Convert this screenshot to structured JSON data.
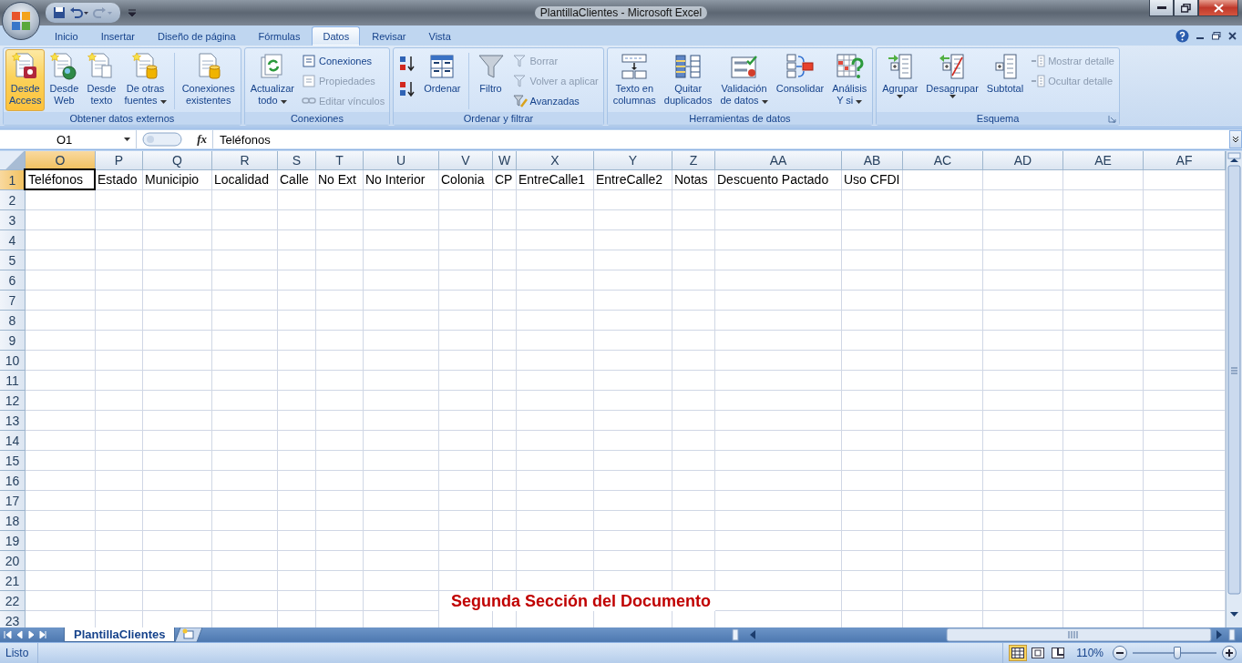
{
  "window": {
    "title": "PlantillaClientes - Microsoft Excel"
  },
  "tabs": [
    {
      "label": "Inicio",
      "selected": false
    },
    {
      "label": "Insertar",
      "selected": false
    },
    {
      "label": "Diseño de página",
      "selected": false
    },
    {
      "label": "Fórmulas",
      "selected": false
    },
    {
      "label": "Datos",
      "selected": true
    },
    {
      "label": "Revisar",
      "selected": false
    },
    {
      "label": "Vista",
      "selected": false
    }
  ],
  "ribbon": [
    {
      "title": "Obtener datos externos",
      "launcher": false,
      "items": [
        {
          "kind": "large",
          "lines": [
            "Desde",
            "Access"
          ],
          "highlighted": true,
          "dropdown": false
        },
        {
          "kind": "large",
          "lines": [
            "Desde",
            "Web"
          ],
          "highlighted": false,
          "dropdown": false
        },
        {
          "kind": "large",
          "lines": [
            "Desde",
            "texto"
          ],
          "highlighted": false,
          "dropdown": false
        },
        {
          "kind": "large",
          "lines": [
            "De otras",
            "fuentes"
          ],
          "highlighted": false,
          "dropdown": true
        },
        {
          "kind": "separator"
        },
        {
          "kind": "large",
          "lines": [
            "Conexiones",
            "existentes"
          ],
          "highlighted": false,
          "dropdown": false
        }
      ]
    },
    {
      "title": "Conexiones",
      "launcher": false,
      "items": [
        {
          "kind": "large",
          "lines": [
            "Actualizar",
            "todo"
          ],
          "highlighted": false,
          "dropdown": true
        },
        {
          "kind": "small",
          "lines": [
            "Conexiones"
          ],
          "disabled": false
        },
        {
          "kind": "small",
          "lines": [
            "Propiedades"
          ],
          "disabled": true
        },
        {
          "kind": "small",
          "lines": [
            "Editar vínculos"
          ],
          "disabled": true
        }
      ]
    },
    {
      "title": "Ordenar y filtrar",
      "launcher": false,
      "items": [
        {
          "kind": "icon"
        },
        {
          "kind": "icon"
        },
        {
          "kind": "large",
          "lines": [
            "Ordenar"
          ],
          "highlighted": false,
          "dropdown": false
        },
        {
          "kind": "separator"
        },
        {
          "kind": "large",
          "lines": [
            "Filtro"
          ],
          "highlighted": false,
          "dropdown": false
        },
        {
          "kind": "small",
          "lines": [
            "Borrar"
          ],
          "disabled": true
        },
        {
          "kind": "small",
          "lines": [
            "Volver a aplicar"
          ],
          "disabled": true
        },
        {
          "kind": "small",
          "lines": [
            "Avanzadas"
          ],
          "disabled": false
        }
      ]
    },
    {
      "title": "Herramientas de datos",
      "launcher": false,
      "items": [
        {
          "kind": "large",
          "lines": [
            "Texto en",
            "columnas"
          ],
          "highlighted": false,
          "dropdown": false
        },
        {
          "kind": "large",
          "lines": [
            "Quitar",
            "duplicados"
          ],
          "highlighted": false,
          "dropdown": false
        },
        {
          "kind": "large",
          "lines": [
            "Validación",
            "de datos"
          ],
          "highlighted": false,
          "dropdown": true
        },
        {
          "kind": "large",
          "lines": [
            "Consolidar"
          ],
          "highlighted": false,
          "dropdown": false
        },
        {
          "kind": "large",
          "lines": [
            "Análisis",
            "Y si"
          ],
          "highlighted": false,
          "dropdown": true
        }
      ]
    },
    {
      "title": "Esquema",
      "launcher": true,
      "items": [
        {
          "kind": "large",
          "lines": [
            "Agrupar"
          ],
          "highlighted": false,
          "dropdown": true
        },
        {
          "kind": "large",
          "lines": [
            "Desagrupar"
          ],
          "highlighted": false,
          "dropdown": true
        },
        {
          "kind": "large",
          "lines": [
            "Subtotal"
          ],
          "highlighted": false,
          "dropdown": false
        },
        {
          "kind": "small",
          "lines": [
            "Mostrar detalle"
          ],
          "disabled": true
        },
        {
          "kind": "small",
          "lines": [
            "Ocultar detalle"
          ],
          "disabled": true
        }
      ]
    }
  ],
  "formula_bar": {
    "name_box": "O1",
    "function_button": "fx",
    "value": "Teléfonos"
  },
  "sheet": {
    "columns": [
      {
        "label": "O",
        "selected": true
      },
      {
        "label": "P",
        "selected": false
      },
      {
        "label": "Q",
        "selected": false
      },
      {
        "label": "R",
        "selected": false
      },
      {
        "label": "S",
        "selected": false
      },
      {
        "label": "T",
        "selected": false
      },
      {
        "label": "U",
        "selected": false
      },
      {
        "label": "V",
        "selected": false
      },
      {
        "label": "W",
        "selected": false
      },
      {
        "label": "X",
        "selected": false
      },
      {
        "label": "Y",
        "selected": false
      },
      {
        "label": "Z",
        "selected": false
      },
      {
        "label": "AA",
        "selected": false
      },
      {
        "label": "AB",
        "selected": false
      },
      {
        "label": "AC",
        "selected": false
      },
      {
        "label": "AD",
        "selected": false
      },
      {
        "label": "AE",
        "selected": false
      },
      {
        "label": "AF",
        "selected": false
      }
    ],
    "rows": [
      {
        "label": "1",
        "selected": true,
        "cells": [
          {
            "text": "Teléfonos",
            "active": true
          },
          {
            "text": "Estado",
            "active": false
          },
          {
            "text": "Municipio",
            "active": false
          },
          {
            "text": "Localidad",
            "active": false
          },
          {
            "text": "Calle",
            "active": false
          },
          {
            "text": "No Ext",
            "active": false
          },
          {
            "text": "No Interior",
            "active": false
          },
          {
            "text": "Colonia",
            "active": false
          },
          {
            "text": "CP",
            "active": false
          },
          {
            "text": "EntreCalle1",
            "active": false
          },
          {
            "text": "EntreCalle2",
            "active": false
          },
          {
            "text": "Notas",
            "active": false
          },
          {
            "text": "Descuento Pactado",
            "active": false
          },
          {
            "text": "Uso CFDI",
            "active": false
          }
        ]
      },
      {
        "label": "2",
        "selected": false
      },
      {
        "label": "3",
        "selected": false
      },
      {
        "label": "4",
        "selected": false
      },
      {
        "label": "5",
        "selected": false
      },
      {
        "label": "6",
        "selected": false
      },
      {
        "label": "7",
        "selected": false
      },
      {
        "label": "8",
        "selected": false
      },
      {
        "label": "9",
        "selected": false
      },
      {
        "label": "10",
        "selected": false
      },
      {
        "label": "11",
        "selected": false
      },
      {
        "label": "12",
        "selected": false
      },
      {
        "label": "13",
        "selected": false
      },
      {
        "label": "14",
        "selected": false
      },
      {
        "label": "15",
        "selected": false
      },
      {
        "label": "16",
        "selected": false
      },
      {
        "label": "17",
        "selected": false
      },
      {
        "label": "18",
        "selected": false
      },
      {
        "label": "19",
        "selected": false
      },
      {
        "label": "20",
        "selected": false
      },
      {
        "label": "21",
        "selected": false
      },
      {
        "label": "22",
        "selected": false
      },
      {
        "label": "23",
        "selected": false
      }
    ],
    "overlay_text": "Segunda Sección del Documento"
  },
  "sheet_tabs": [
    {
      "label": "PlantillaClientes",
      "selected": true
    }
  ],
  "status_bar": {
    "text": "Listo",
    "views": [
      {
        "selected": true
      },
      {
        "selected": false
      },
      {
        "selected": false
      }
    ],
    "zoom": {
      "reading": "110%",
      "level": 0.53
    }
  }
}
